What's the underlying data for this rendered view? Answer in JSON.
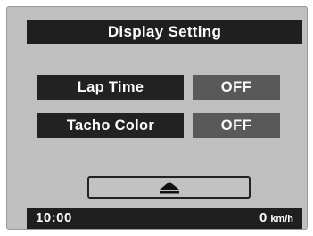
{
  "header": {
    "title": "Display Setting"
  },
  "settings": [
    {
      "label": "Lap Time",
      "value": "OFF"
    },
    {
      "label": "Tacho Color",
      "value": "OFF"
    }
  ],
  "navigation": {
    "up_icon": "up-triangle-icon"
  },
  "status": {
    "time": "10:00",
    "speed": "0",
    "speed_unit": "km/h"
  },
  "colors": {
    "screen_background": "#bfbfbf",
    "bar_background": "#1f1f1f",
    "value_background": "#595959",
    "text": "#ffffff"
  }
}
